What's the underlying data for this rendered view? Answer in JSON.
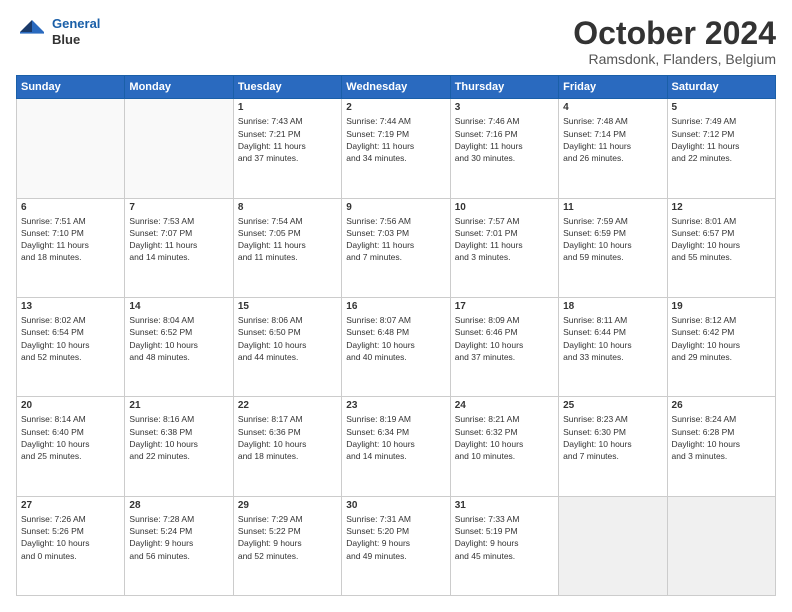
{
  "header": {
    "logo_line1": "General",
    "logo_line2": "Blue",
    "month": "October 2024",
    "location": "Ramsdonk, Flanders, Belgium"
  },
  "weekdays": [
    "Sunday",
    "Monday",
    "Tuesday",
    "Wednesday",
    "Thursday",
    "Friday",
    "Saturday"
  ],
  "weeks": [
    [
      {
        "day": "",
        "empty": true
      },
      {
        "day": "",
        "empty": true
      },
      {
        "day": "1",
        "info": "Sunrise: 7:43 AM\nSunset: 7:21 PM\nDaylight: 11 hours\nand 37 minutes."
      },
      {
        "day": "2",
        "info": "Sunrise: 7:44 AM\nSunset: 7:19 PM\nDaylight: 11 hours\nand 34 minutes."
      },
      {
        "day": "3",
        "info": "Sunrise: 7:46 AM\nSunset: 7:16 PM\nDaylight: 11 hours\nand 30 minutes."
      },
      {
        "day": "4",
        "info": "Sunrise: 7:48 AM\nSunset: 7:14 PM\nDaylight: 11 hours\nand 26 minutes."
      },
      {
        "day": "5",
        "info": "Sunrise: 7:49 AM\nSunset: 7:12 PM\nDaylight: 11 hours\nand 22 minutes."
      }
    ],
    [
      {
        "day": "6",
        "info": "Sunrise: 7:51 AM\nSunset: 7:10 PM\nDaylight: 11 hours\nand 18 minutes."
      },
      {
        "day": "7",
        "info": "Sunrise: 7:53 AM\nSunset: 7:07 PM\nDaylight: 11 hours\nand 14 minutes."
      },
      {
        "day": "8",
        "info": "Sunrise: 7:54 AM\nSunset: 7:05 PM\nDaylight: 11 hours\nand 11 minutes."
      },
      {
        "day": "9",
        "info": "Sunrise: 7:56 AM\nSunset: 7:03 PM\nDaylight: 11 hours\nand 7 minutes."
      },
      {
        "day": "10",
        "info": "Sunrise: 7:57 AM\nSunset: 7:01 PM\nDaylight: 11 hours\nand 3 minutes."
      },
      {
        "day": "11",
        "info": "Sunrise: 7:59 AM\nSunset: 6:59 PM\nDaylight: 10 hours\nand 59 minutes."
      },
      {
        "day": "12",
        "info": "Sunrise: 8:01 AM\nSunset: 6:57 PM\nDaylight: 10 hours\nand 55 minutes."
      }
    ],
    [
      {
        "day": "13",
        "info": "Sunrise: 8:02 AM\nSunset: 6:54 PM\nDaylight: 10 hours\nand 52 minutes."
      },
      {
        "day": "14",
        "info": "Sunrise: 8:04 AM\nSunset: 6:52 PM\nDaylight: 10 hours\nand 48 minutes."
      },
      {
        "day": "15",
        "info": "Sunrise: 8:06 AM\nSunset: 6:50 PM\nDaylight: 10 hours\nand 44 minutes."
      },
      {
        "day": "16",
        "info": "Sunrise: 8:07 AM\nSunset: 6:48 PM\nDaylight: 10 hours\nand 40 minutes."
      },
      {
        "day": "17",
        "info": "Sunrise: 8:09 AM\nSunset: 6:46 PM\nDaylight: 10 hours\nand 37 minutes."
      },
      {
        "day": "18",
        "info": "Sunrise: 8:11 AM\nSunset: 6:44 PM\nDaylight: 10 hours\nand 33 minutes."
      },
      {
        "day": "19",
        "info": "Sunrise: 8:12 AM\nSunset: 6:42 PM\nDaylight: 10 hours\nand 29 minutes."
      }
    ],
    [
      {
        "day": "20",
        "info": "Sunrise: 8:14 AM\nSunset: 6:40 PM\nDaylight: 10 hours\nand 25 minutes."
      },
      {
        "day": "21",
        "info": "Sunrise: 8:16 AM\nSunset: 6:38 PM\nDaylight: 10 hours\nand 22 minutes."
      },
      {
        "day": "22",
        "info": "Sunrise: 8:17 AM\nSunset: 6:36 PM\nDaylight: 10 hours\nand 18 minutes."
      },
      {
        "day": "23",
        "info": "Sunrise: 8:19 AM\nSunset: 6:34 PM\nDaylight: 10 hours\nand 14 minutes."
      },
      {
        "day": "24",
        "info": "Sunrise: 8:21 AM\nSunset: 6:32 PM\nDaylight: 10 hours\nand 10 minutes."
      },
      {
        "day": "25",
        "info": "Sunrise: 8:23 AM\nSunset: 6:30 PM\nDaylight: 10 hours\nand 7 minutes."
      },
      {
        "day": "26",
        "info": "Sunrise: 8:24 AM\nSunset: 6:28 PM\nDaylight: 10 hours\nand 3 minutes."
      }
    ],
    [
      {
        "day": "27",
        "info": "Sunrise: 7:26 AM\nSunset: 5:26 PM\nDaylight: 10 hours\nand 0 minutes."
      },
      {
        "day": "28",
        "info": "Sunrise: 7:28 AM\nSunset: 5:24 PM\nDaylight: 9 hours\nand 56 minutes."
      },
      {
        "day": "29",
        "info": "Sunrise: 7:29 AM\nSunset: 5:22 PM\nDaylight: 9 hours\nand 52 minutes."
      },
      {
        "day": "30",
        "info": "Sunrise: 7:31 AM\nSunset: 5:20 PM\nDaylight: 9 hours\nand 49 minutes."
      },
      {
        "day": "31",
        "info": "Sunrise: 7:33 AM\nSunset: 5:19 PM\nDaylight: 9 hours\nand 45 minutes."
      },
      {
        "day": "",
        "empty": true
      },
      {
        "day": "",
        "empty": true
      }
    ]
  ]
}
